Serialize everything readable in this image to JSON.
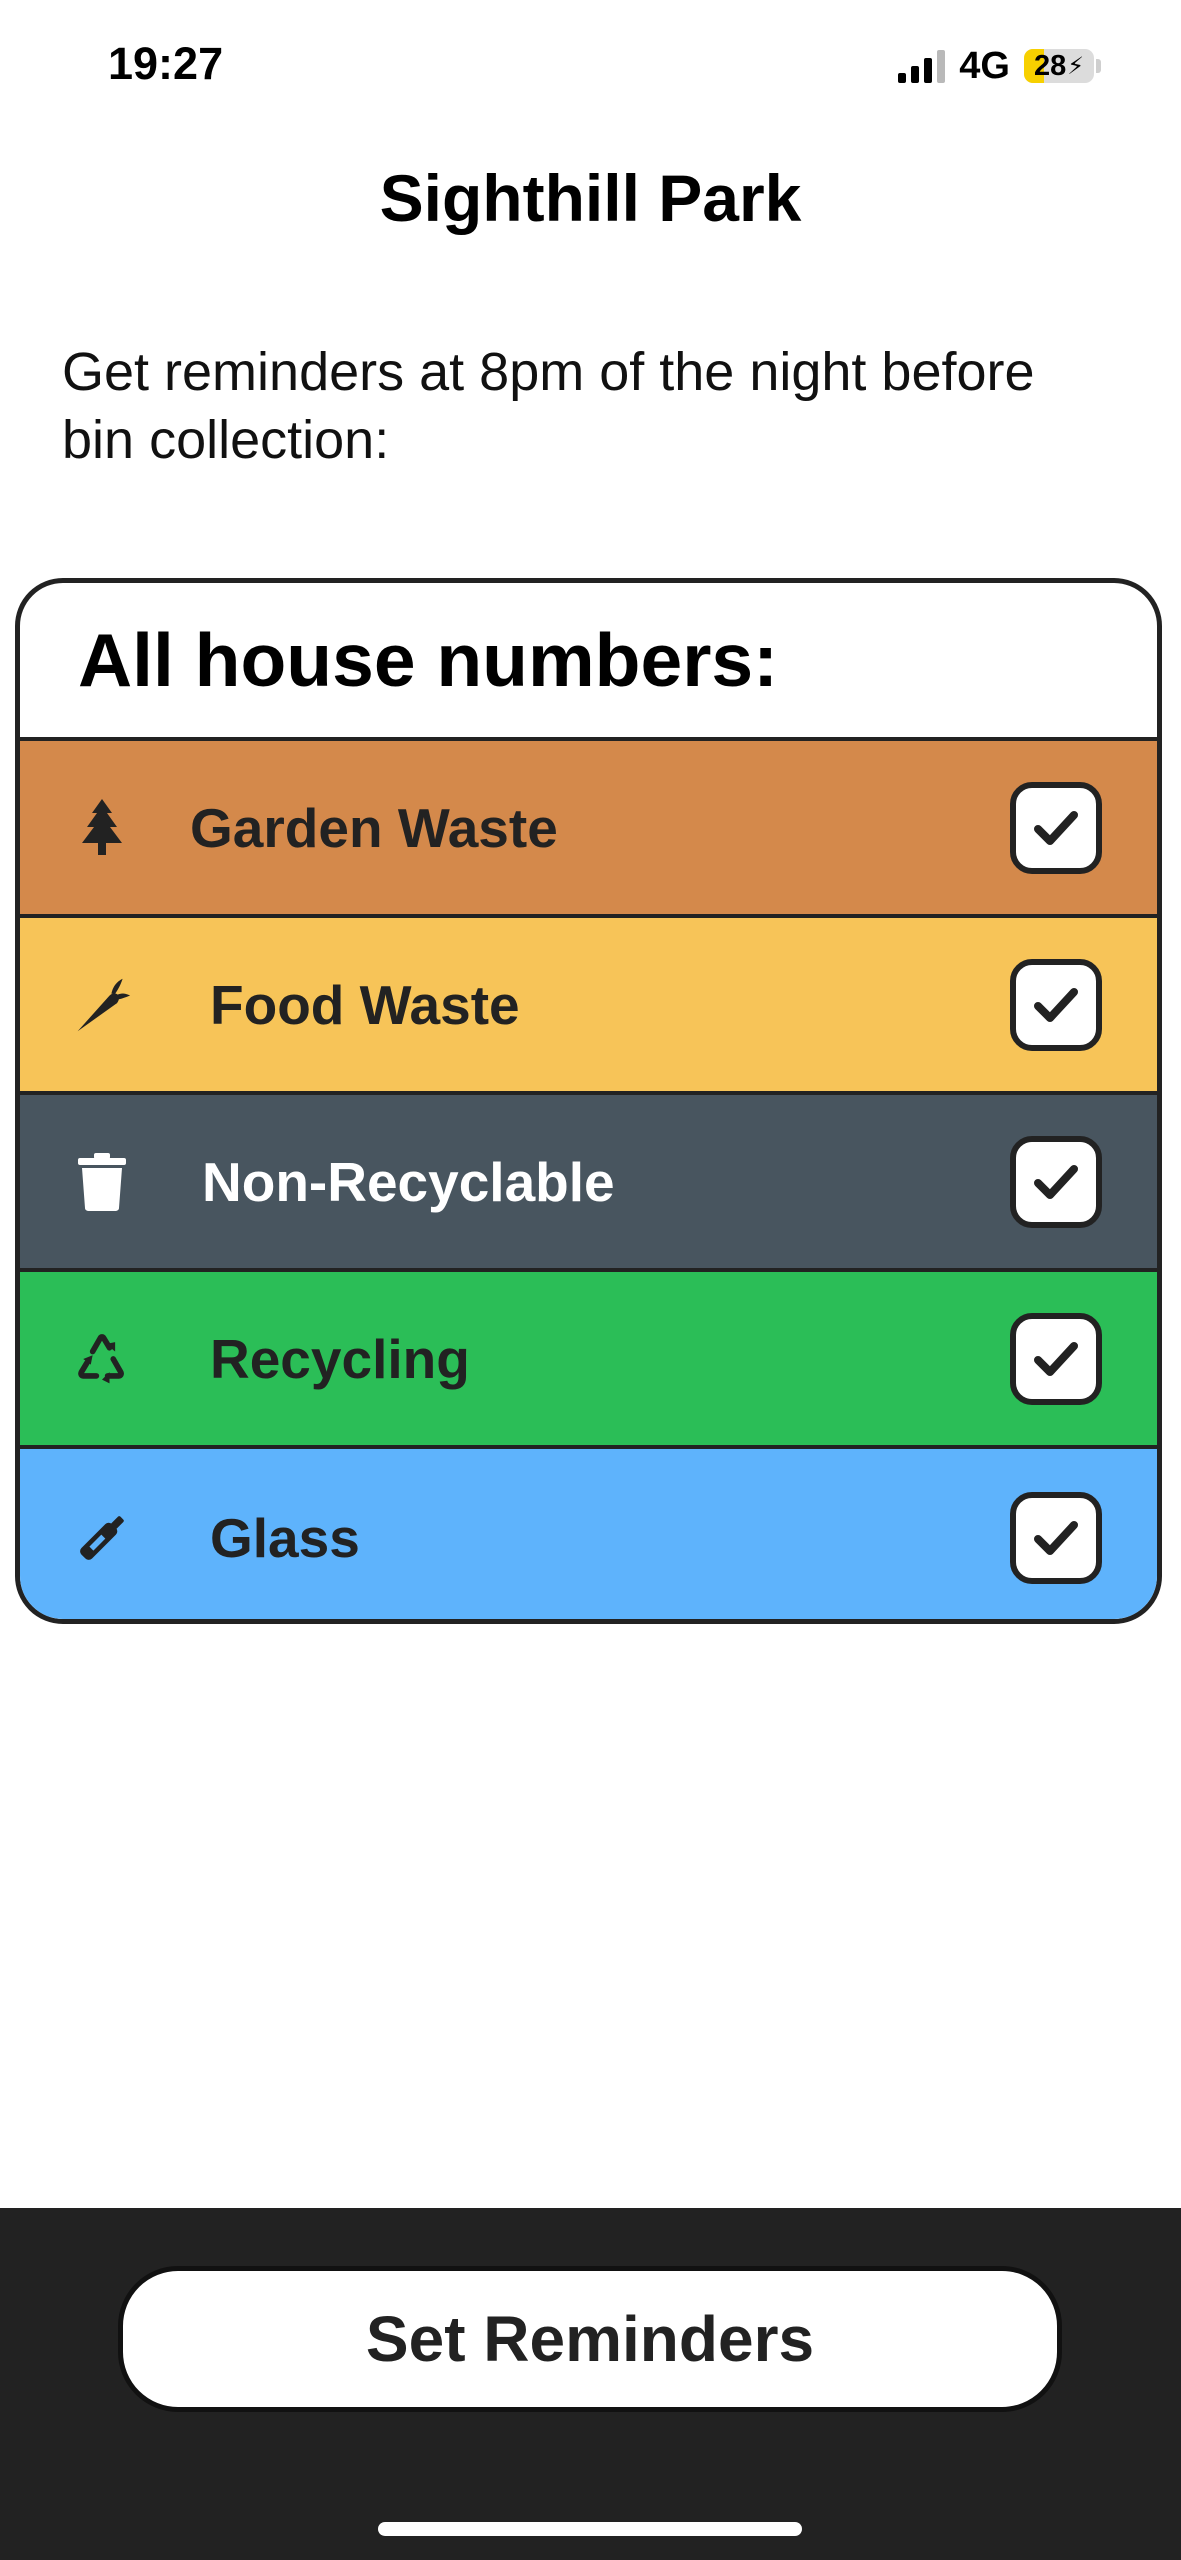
{
  "status_bar": {
    "time": "19:27",
    "network": "4G",
    "battery_level": "28",
    "battery_percent": 28,
    "battery_color": "#f7d000"
  },
  "title": "Sighthill Park",
  "intro": "Get reminders at 8pm of the night before bin collection:",
  "card": {
    "header": "All house numbers:",
    "bins": [
      {
        "label": "Garden Waste",
        "icon": "tree-icon",
        "color": "#d4894b",
        "text_color": "#222222",
        "checked": true
      },
      {
        "label": "Food Waste",
        "icon": "carrot-icon",
        "color": "#f7c458",
        "text_color": "#222222",
        "checked": true
      },
      {
        "label": "Non-Recyclable",
        "icon": "trash-icon",
        "color": "#48555f",
        "text_color": "#ffffff",
        "checked": true
      },
      {
        "label": "Recycling",
        "icon": "recycle-icon",
        "color": "#2bbe57",
        "text_color": "#222222",
        "checked": true
      },
      {
        "label": "Glass",
        "icon": "bottle-icon",
        "color": "#5eb3fc",
        "text_color": "#222222",
        "checked": true
      }
    ]
  },
  "action": {
    "label": "Set Reminders"
  },
  "colors": {
    "bottom_bar": "#222222",
    "border": "#222222"
  }
}
